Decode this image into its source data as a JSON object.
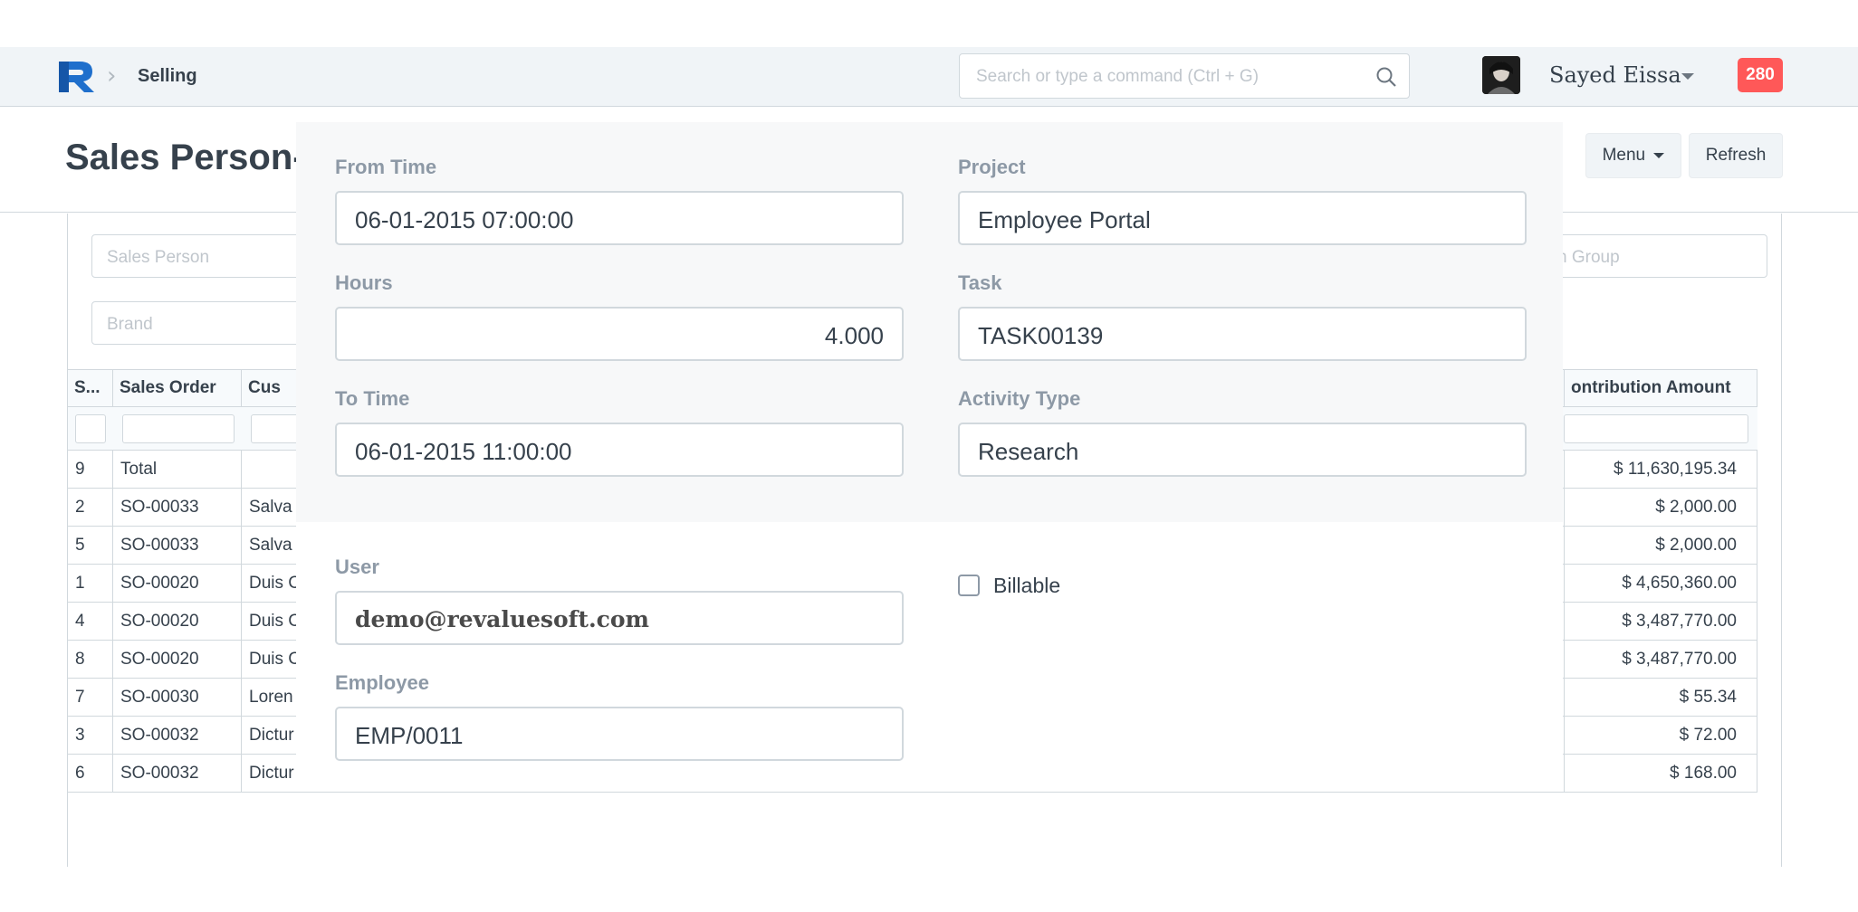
{
  "navbar": {
    "breadcrumb": "Selling",
    "search_placeholder": "Search or type a command (Ctrl + G)",
    "user_name": "Sayed Eissa",
    "notification_count": "280"
  },
  "page": {
    "title": "Sales Person-",
    "menu_label": "Menu",
    "refresh_label": "Refresh"
  },
  "filters": {
    "sales_person": "Sales Person",
    "brand": "Brand",
    "item_group": "n Group"
  },
  "grid": {
    "columns": [
      "S...",
      "Sales Order",
      "Cus",
      "ontribution Amount"
    ],
    "rows": [
      {
        "sr": "9",
        "order": "Total",
        "customer": "",
        "amount": "$ 11,630,195.34"
      },
      {
        "sr": "2",
        "order": "SO-00033",
        "customer": "Salva",
        "amount": "$ 2,000.00"
      },
      {
        "sr": "5",
        "order": "SO-00033",
        "customer": "Salva",
        "amount": "$ 2,000.00"
      },
      {
        "sr": "1",
        "order": "SO-00020",
        "customer": "Duis C",
        "amount": "$ 4,650,360.00"
      },
      {
        "sr": "4",
        "order": "SO-00020",
        "customer": "Duis C",
        "amount": "$ 3,487,770.00"
      },
      {
        "sr": "8",
        "order": "SO-00020",
        "customer": "Duis C",
        "amount": "$ 3,487,770.00"
      },
      {
        "sr": "7",
        "order": "SO-00030",
        "customer": "Loren",
        "amount": "$ 55.34"
      },
      {
        "sr": "3",
        "order": "SO-00032",
        "customer": "Dictur",
        "amount": "$ 72.00"
      },
      {
        "sr": "6",
        "order": "SO-00032",
        "customer": "Dictur",
        "amount": "$ 168.00"
      }
    ]
  },
  "form": {
    "from_time_label": "From Time",
    "from_time_value": "06-01-2015 07:00:00",
    "hours_label": "Hours",
    "hours_value": "4.000",
    "to_time_label": "To Time",
    "to_time_value": "06-01-2015 11:00:00",
    "project_label": "Project",
    "project_value": "Employee Portal",
    "task_label": "Task",
    "task_value": "TASK00139",
    "activity_label": "Activity Type",
    "activity_value": "Research",
    "user_label": "User",
    "user_value": "demo@revaluesoft.com",
    "billable_label": "Billable",
    "billable_checked": false,
    "employee_label": "Employee",
    "employee_value": "EMP/0011"
  },
  "colors": {
    "notification_bg": "#ff5858",
    "logo_blue": "#1f6fcc",
    "label_gray": "#8d99a6"
  },
  "icons": [
    "logo-icon",
    "chevron-right-icon",
    "search-icon",
    "avatar",
    "caret-down-icon",
    "checkbox-icon"
  ]
}
